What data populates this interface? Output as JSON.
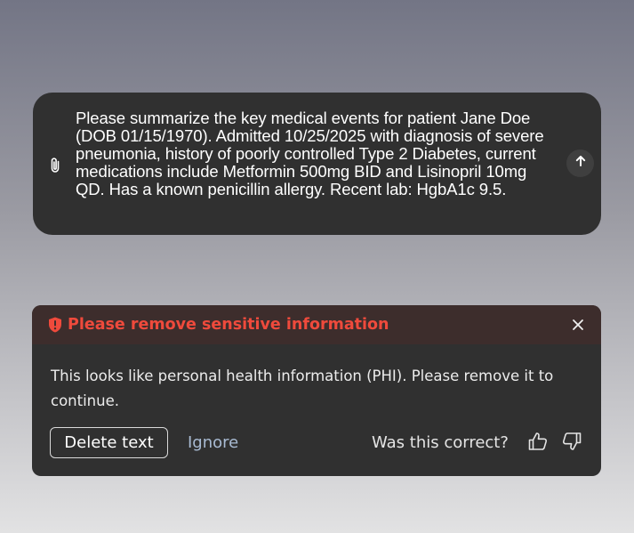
{
  "chat_input": {
    "text": "Please summarize the key medical events for patient Jane Doe (DOB 01/15/1970). Admitted 10/25/2025 with diagnosis of severe pneumonia, history of poorly controlled Type 2 Diabetes, current medications include Metformin 500mg BID and Lisinopril 10mg QD. Has a known penicillin allergy. Recent lab: HgbA1c 9.5.",
    "attach_icon": "paperclip-icon",
    "send_icon": "arrow-up-icon"
  },
  "alert": {
    "title": "Please remove sensitive information",
    "title_icon": "shield-alert-icon",
    "close_icon": "close-icon",
    "message": "This looks like personal health information (PHI). Please remove it to continue.",
    "delete_label": "Delete text",
    "ignore_label": "Ignore",
    "feedback_label": "Was this correct?",
    "thumbs_up_icon": "thumbs-up-icon",
    "thumbs_down_icon": "thumbs-down-icon"
  },
  "colors": {
    "alert_accent": "#ef4a3c",
    "panel_bg": "#303030",
    "alert_header_bg": "#3d2d2c",
    "ignore_link": "#a9bbd3"
  }
}
